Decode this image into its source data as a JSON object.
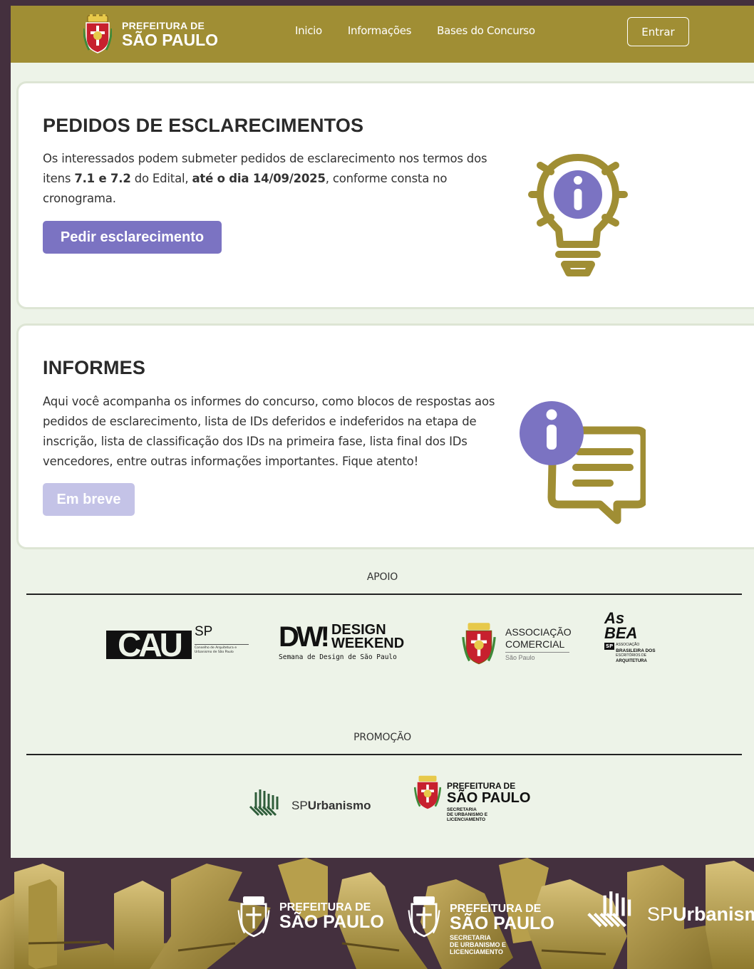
{
  "header": {
    "brand_line1": "PREFEITURA DE",
    "brand_line2": "SÃO PAULO",
    "nav": [
      "Inicio",
      "Informações",
      "Bases do Concurso"
    ],
    "login": "Entrar"
  },
  "clarification": {
    "title": "PEDIDOS DE ESCLARECIMENTOS",
    "text_1": "Os interessados podem submeter pedidos de esclarecimento nos termos dos itens ",
    "text_bold_1": "7.1 e 7.2",
    "text_2": " do Edital, ",
    "text_bold_2": "até o dia 14/09/2025",
    "text_3": ", conforme consta no cronograma.",
    "button": "Pedir esclarecimento"
  },
  "informes": {
    "title": "INFORMES",
    "text": "Aqui você acompanha os informes do concurso, como blocos de respostas aos pedidos de esclarecimento, lista de IDs deferidos e indeferidos na etapa de inscrição, lista de classificação dos IDs na primeira fase, lista final dos IDs vencedores, entre outras informações importantes. Fique atento!",
    "button": "Em breve"
  },
  "support": {
    "label": "APOIO",
    "cau": {
      "mark": "CAU",
      "sp": "SP",
      "sub": "Conselho de Arquitetura e Urbanismo de São Paulo"
    },
    "dw": {
      "mark": "DW!",
      "line1": "DESIGN",
      "line2": "WEEKEND",
      "sub": "Semana de Design de São Paulo"
    },
    "acsp": {
      "line1": "ASSOCIAÇÃO",
      "line2": "COMERCIAL",
      "sub": "São Paulo"
    },
    "asbea": {
      "mark1": "As",
      "mark2": "BEA",
      "sp": "SP",
      "line1": "ASSOCIAÇÃO",
      "line2": "BRASILEIRA DOS",
      "line3": "ESCRITÓRIOS DE",
      "line4": "ARQUITETURA"
    }
  },
  "promotion": {
    "label": "PROMOÇÃO",
    "spurb": {
      "sp": "SP",
      "name": "Urbanismo"
    },
    "pref": {
      "line1": "PREFEITURA DE",
      "line2": "SÃO PAULO",
      "sub1": "SECRETARIA",
      "sub2": "DE URBANISMO E",
      "sub3": "LICENCIAMENTO"
    }
  },
  "footer": {
    "pref_line1": "PREFEITURA DE",
    "pref_line2": "SÃO PAULO",
    "smul_line1": "PREFEITURA DE",
    "smul_line2": "SÃO PAULO",
    "smul_sub1": "SECRETARIA",
    "smul_sub2": "DE URBANISMO E",
    "smul_sub3": "LICENCIAMENTO",
    "spurb_sp": "SP",
    "spurb_name": "Urbanism"
  },
  "colors": {
    "navbar": "#a08e34",
    "primary_button": "#7b73c2",
    "disabled_button": "#c4c3e7",
    "background": "#44303e",
    "page": "#edf3e8",
    "icon_gold": "#a08e34",
    "icon_purple": "#7b73c2"
  }
}
